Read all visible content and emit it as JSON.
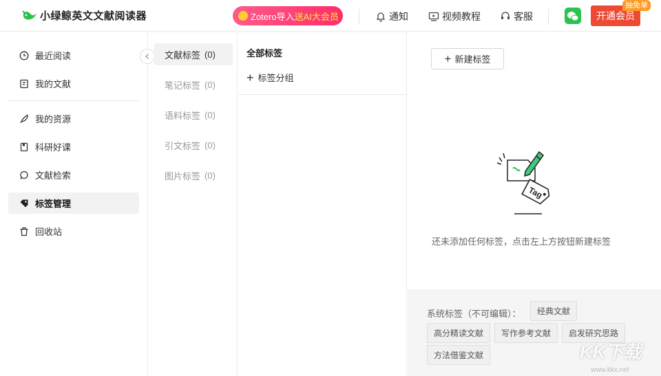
{
  "header": {
    "app_title": "小绿鲸英文文献阅读器",
    "promo_prefix": "Zotero导入",
    "promo_highlight": "送AI大会员",
    "nav_notify": "通知",
    "nav_video": "视频教程",
    "nav_service": "客服",
    "vip_button": "开通会员",
    "vip_badge": "抽免单"
  },
  "sidebar": {
    "items": [
      {
        "label": "最近阅读",
        "icon": "clock-icon"
      },
      {
        "label": "我的文献",
        "icon": "document-icon"
      },
      {
        "label": "我的资源",
        "icon": "feather-icon"
      },
      {
        "label": "科研好课",
        "icon": "bookmark-icon"
      },
      {
        "label": "文献检索",
        "icon": "search-icon"
      },
      {
        "label": "标签管理",
        "icon": "tag-icon"
      },
      {
        "label": "回收站",
        "icon": "trash-icon"
      }
    ],
    "collapse_icon": "chevron-left-icon"
  },
  "categories": [
    {
      "label": "文献标签",
      "count": "(0)"
    },
    {
      "label": "笔记标签",
      "count": "(0)"
    },
    {
      "label": "语料标签",
      "count": "(0)"
    },
    {
      "label": "引文标签",
      "count": "(0)"
    },
    {
      "label": "图片标签",
      "count": "(0)"
    }
  ],
  "groups": {
    "title": "全部标签",
    "add_label": "标签分组"
  },
  "main": {
    "new_tag_label": "新建标签",
    "empty_text": "还未添加任何标签，点击左上方按钮新建标签",
    "illustration_text": "Tag"
  },
  "system_tags": {
    "label": "系统标签（不可编辑）：",
    "tags": [
      "经典文献",
      "高分精读文献",
      "写作参考文献",
      "启发研究思路",
      "方法借鉴文献"
    ]
  },
  "watermark": {
    "text": "KK下载",
    "url": "www.kkx.net"
  },
  "colors": {
    "accent": "#2dc24f",
    "vip": "#ee4a33",
    "promo": "#ff2d6a"
  }
}
